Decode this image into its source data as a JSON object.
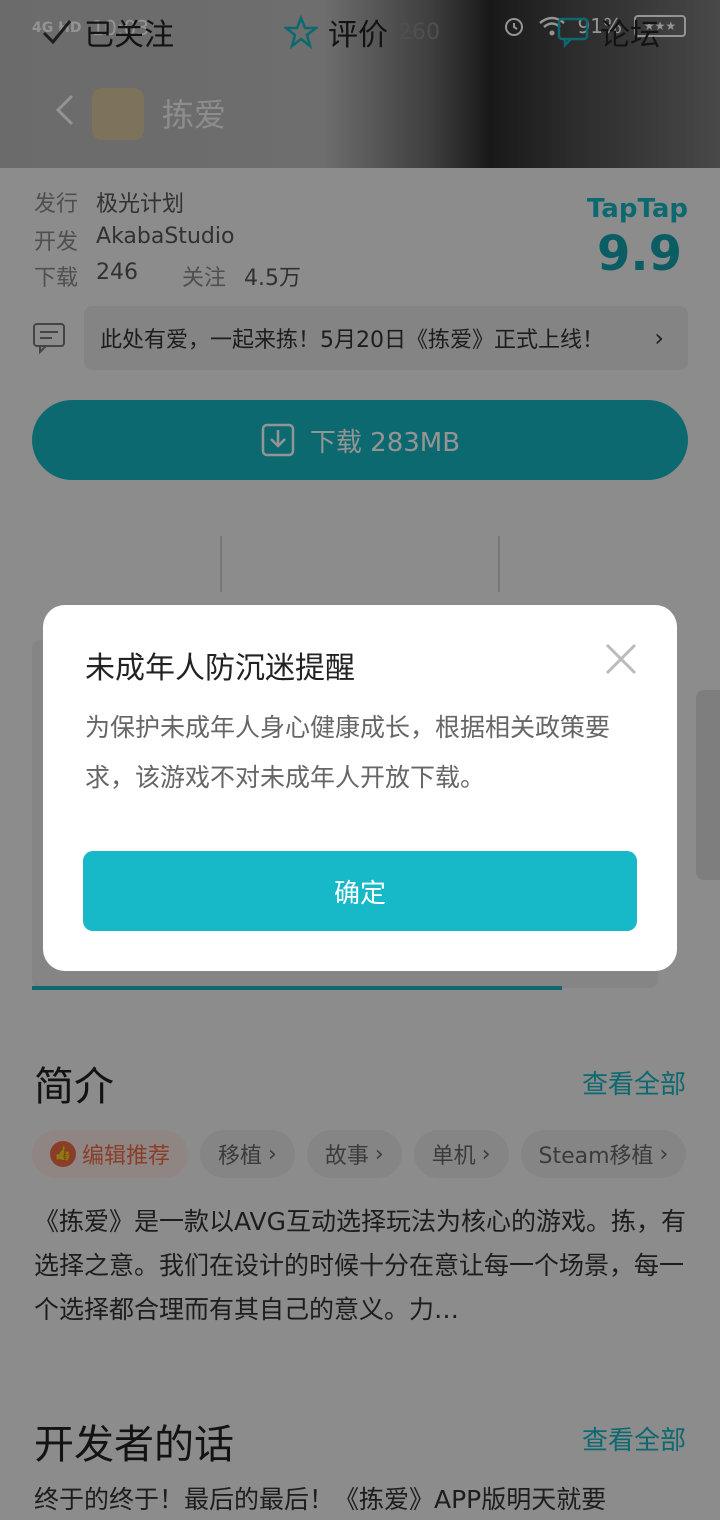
{
  "status_bar": {
    "network": "4G HD",
    "time": "10:03",
    "battery": "91%"
  },
  "app": {
    "title": "拣爱"
  },
  "info": {
    "publisher_label": "发行",
    "publisher": "极光计划",
    "developer_label": "开发",
    "developer": "AkabaStudio",
    "downloads_label": "下载",
    "downloads": "246",
    "follows_label": "关注",
    "follows": "4.5万",
    "brand": "TapTap",
    "score": "9.9"
  },
  "notice": {
    "text": "此处有爱，一起来拣！5月20日《拣爱》正式上线！",
    "arrow": "›"
  },
  "download": {
    "label": "下载 283MB"
  },
  "actions": {
    "follow": "已关注",
    "review": "评价",
    "review_count": "260",
    "forum": "论坛"
  },
  "intro": {
    "title": "简介",
    "more": "查看全部",
    "tags": [
      {
        "label": "编辑推荐"
      },
      {
        "label": "移植"
      },
      {
        "label": "故事"
      },
      {
        "label": "单机"
      },
      {
        "label": "Steam移植"
      }
    ],
    "text": "《拣爱》是一款以AVG互动选择玩法为核心的游戏。拣，有选择之意。我们在设计的时候十分在意让每一个场景，每一个选择都合理而有其自己的意义。力…"
  },
  "developer_words": {
    "title": "开发者的话",
    "more": "查看全部",
    "text": "终于的终于！最后的最后！《拣爱》APP版明天就要"
  },
  "modal": {
    "title": "未成年人防沉迷提醒",
    "body": "为保护未成年人身心健康成长，根据相关政策要求，该游戏不对未成年人开放下载。",
    "confirm": "确定"
  },
  "colors": {
    "accent": "#15b5c2",
    "hot_tag": "#ee6a46"
  }
}
